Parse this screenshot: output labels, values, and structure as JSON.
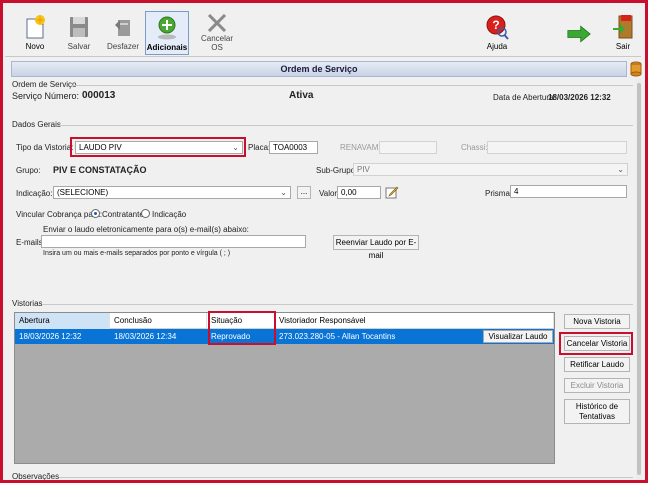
{
  "toolbar": {
    "novo": "Novo",
    "salvar": "Salvar",
    "desfazer": "Desfazer",
    "adicionais": "Adicionais",
    "cancelar_os_line1": "Cancelar",
    "cancelar_os_line2": "OS",
    "ajuda": "Ajuda",
    "sair": "Sair"
  },
  "title": "Ordem de Serviço",
  "header": {
    "section_label": "Ordem de Serviço",
    "servico_label": "Serviço Número:",
    "servico_numero": "000013",
    "status": "Ativa",
    "abertura_label": "Data de Abertura:",
    "abertura_valor": "18/03/2026 12:32"
  },
  "dados_gerais": {
    "section_label": "Dados Gerais",
    "tipo_label": "Tipo da Vistoria:",
    "tipo_valor": "LAUDO PIV",
    "placa_label": "Placa:",
    "placa_valor": "TOA0003",
    "renavam_label": "RENAVAM:",
    "chassi_label": "Chassi:",
    "grupo_label": "Grupo:",
    "grupo_valor": "PIV E CONSTATAÇÃO",
    "subgrupo_label": "Sub-Grupo:",
    "subgrupo_valor": "PIV",
    "indicacao_label": "Indicação:",
    "indicacao_valor": "(SELECIONE)",
    "ellipsis": "...",
    "valor_label": "Valor:",
    "valor_valor": "0,00",
    "prisma_label": "Prisma:",
    "prisma_valor": "4",
    "vincular_label": "Vincular Cobrança para:",
    "opt_contratante": "Contratante",
    "opt_indicacao": "Indicação",
    "enviar_texto": "Enviar o laudo eletronicamente para o(s) e-mail(s) abaixo:",
    "emails_label": "E-mails:",
    "emails_valor": "",
    "reenviar": "Reenviar Laudo por E-mail",
    "emails_hint": "Insira um ou mais e-mails separados por ponto e vírgula ( ; )"
  },
  "vistorias": {
    "section_label": "Vistorias",
    "columns": [
      "Abertura",
      "Conclusão",
      "Situação",
      "Vistoriador Responsável"
    ],
    "rows": [
      {
        "abertura": "18/03/2026 12:32",
        "conclusao": "18/03/2026 12:34",
        "situacao": "Reprovado",
        "vistoriador": "273.023.280-05 - Allan Tocantins",
        "acao": "Visualizar Laudo"
      }
    ],
    "buttons": {
      "nova": "Nova Vistoria",
      "cancelar": "Cancelar Vistoria",
      "retificar": "Retificar Laudo",
      "excluir": "Excluir Vistoria",
      "historico_line1": "Histórico de",
      "historico_line2": "Tentativas"
    }
  },
  "observacoes_label": "Observações",
  "colors": {
    "highlight": "#c8102e",
    "row_selected": "#0a74d6",
    "title_bar": "#d4dceb"
  }
}
